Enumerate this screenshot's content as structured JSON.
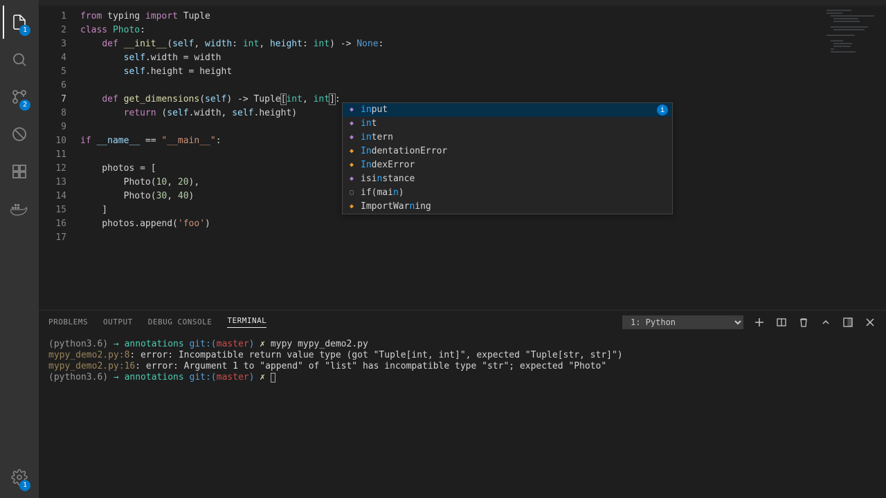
{
  "activity": {
    "explorer_badge": "1",
    "scm_badge": "2",
    "settings_badge": "1"
  },
  "code": {
    "lines": [
      1,
      2,
      3,
      4,
      5,
      6,
      7,
      8,
      9,
      10,
      11,
      12,
      13,
      14,
      15,
      16,
      17
    ],
    "active_line": 7
  },
  "autocomplete": {
    "items": [
      {
        "kind": "purple",
        "pre": "in",
        "rest": "put",
        "selected": true,
        "info": true
      },
      {
        "kind": "purple",
        "pre": "in",
        "rest": "t"
      },
      {
        "kind": "purple",
        "pre": "in",
        "rest": "tern"
      },
      {
        "kind": "orange",
        "pre": "In",
        "rest": "dentationError"
      },
      {
        "kind": "orange",
        "pre": "In",
        "rest": "dexError"
      },
      {
        "kind": "purple",
        "pre": "",
        "rest": "isi",
        "mid": "n",
        "rest2": "stance"
      },
      {
        "kind": "gray",
        "pre": "",
        "rest": "if(mai",
        "mid": "n",
        "rest2": ")",
        "box": true
      },
      {
        "kind": "orange",
        "pre": "",
        "rest": "ImportWar",
        "mid": "n",
        "rest2": "ing"
      }
    ]
  },
  "panel": {
    "tabs": [
      "PROBLEMS",
      "OUTPUT",
      "DEBUG CONSOLE",
      "TERMINAL"
    ],
    "active": "TERMINAL",
    "dropdown": "1: Python",
    "terminal": {
      "prompt_env": "(python3.6)",
      "arrow": "→",
      "dir": "annotations",
      "git": "git:(",
      "branch": "master",
      "git_close": ")",
      "x": "✗",
      "cmd1": "mypy mypy_demo2.py",
      "line2": "mypy_demo2.py:8: error: Incompatible return value type (got \"Tuple[int, int]\", expected \"Tuple[str, str]\")",
      "line3": "mypy_demo2.py:16: error: Argument 1 to \"append\" of \"list\" has incompatible type \"str\"; expected \"Photo\""
    }
  }
}
